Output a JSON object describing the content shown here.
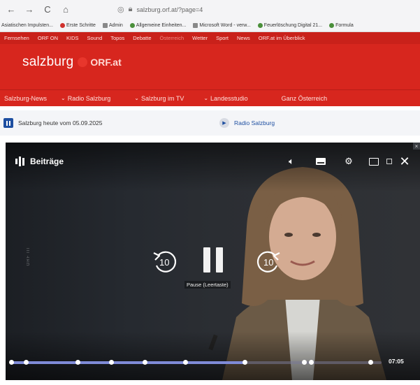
{
  "browser": {
    "nav": {
      "back": "←",
      "forward": "→",
      "reload": "C",
      "home": "⌂"
    },
    "url": "salzburg.orf.at/?page=4",
    "bookmarks": [
      "Asiatischen Impuls­ten...",
      "Erste Schritte",
      "Admin",
      "Allgemeine Einheiten...",
      "Microsoft Word - verw...",
      "Feuerlöschung Digital 21...",
      "Formula"
    ]
  },
  "orf": {
    "top_nav": [
      "Fernsehen",
      "ORF ON",
      "KIDS",
      "Sound",
      "Topos",
      "Debatte",
      "Österreich",
      "Wetter",
      "Sport",
      "News",
      "ORF.at im Überblick"
    ],
    "brand_name": "salzburg",
    "brand_logo": "ORF.at",
    "sub_nav": [
      {
        "label": "Salzburg-News",
        "chevron": false
      },
      {
        "label": "Radio Salzburg",
        "chevron": true
      },
      {
        "label": "Salzburg im TV",
        "chevron": true
      },
      {
        "label": "Landesstudio",
        "chevron": true
      },
      {
        "label": "Ganz Österreich",
        "chevron": false
      }
    ]
  },
  "audio": {
    "title": "Salzburg heute vom 05.09.2025",
    "radio_link": "Radio Salzburg"
  },
  "player": {
    "playlist_label": "Beiträge",
    "rewind_seconds": "10",
    "forward_seconds": "10",
    "pause_tooltip": "Pause (Leertaste)",
    "side_label": "ORF III",
    "time": "07:05",
    "progress_fraction": 0.63,
    "chapter_markers": [
      0.0,
      0.04,
      0.18,
      0.27,
      0.36,
      0.47,
      0.63,
      0.79,
      0.81,
      0.97
    ],
    "accent_color": "#7f8bd8"
  },
  "colors": {
    "orf_red": "#d7261e",
    "link_blue": "#1e4fa1"
  }
}
